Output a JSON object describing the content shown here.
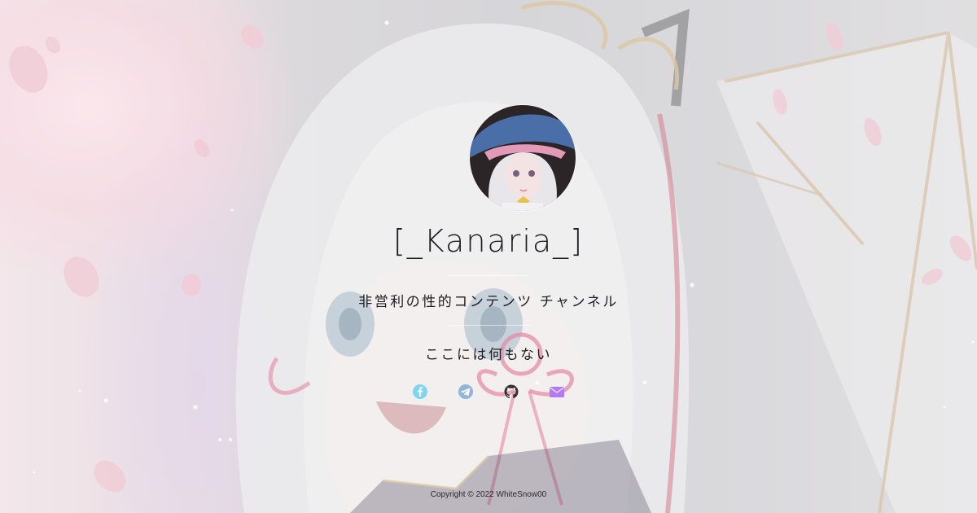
{
  "profile": {
    "name": "[_Kanaria_]",
    "subtitle": "非営利の性的コンテンツ チャンネル",
    "tagline": "ここには何もない",
    "avatar_icon": "avatar-photo"
  },
  "socials": [
    {
      "icon": "facebook-icon",
      "color": "#7fd6f3"
    },
    {
      "icon": "telegram-icon",
      "color": "#8fb6d8"
    },
    {
      "icon": "github-icon",
      "color": "#333333"
    },
    {
      "icon": "email-icon",
      "color": "#b27cf0"
    }
  ],
  "footer": {
    "copyright": "Copyright © 2022 WhiteSnow00"
  }
}
